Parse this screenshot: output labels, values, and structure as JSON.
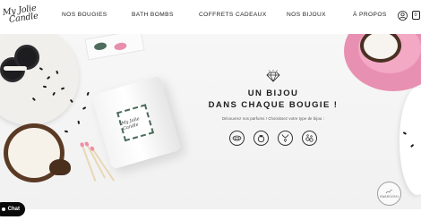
{
  "header": {
    "logo_lines": [
      "My Jolie",
      "Candle"
    ],
    "nav": [
      {
        "label": "NOS BOUGIES"
      },
      {
        "label": "BATH BOMBS"
      },
      {
        "label": "COFFRETS CADEAUX"
      },
      {
        "label": "NOS BIJOUX"
      },
      {
        "label": "À PROPOS"
      }
    ],
    "cart_count": "0"
  },
  "hero": {
    "title_line1": "UN BIJOU",
    "title_line2": "DANS CHAQUE BOUGIE !",
    "subtitle": "Découvrez nos parfums ! Choisissez votre type de bijou :",
    "choices": [
      {
        "icon": "bracelet-icon"
      },
      {
        "icon": "ring-icon"
      },
      {
        "icon": "necklace-icon"
      },
      {
        "icon": "earrings-icon"
      }
    ],
    "candle_label": "My Jolie Candle",
    "badge_text": "SWAROVSKI"
  },
  "chat": {
    "label": "Chat"
  },
  "colors": {
    "brand_dark": "#1c1c1c",
    "pink_plate": "#e890b1",
    "leaf_green": "#4e6b5b"
  }
}
